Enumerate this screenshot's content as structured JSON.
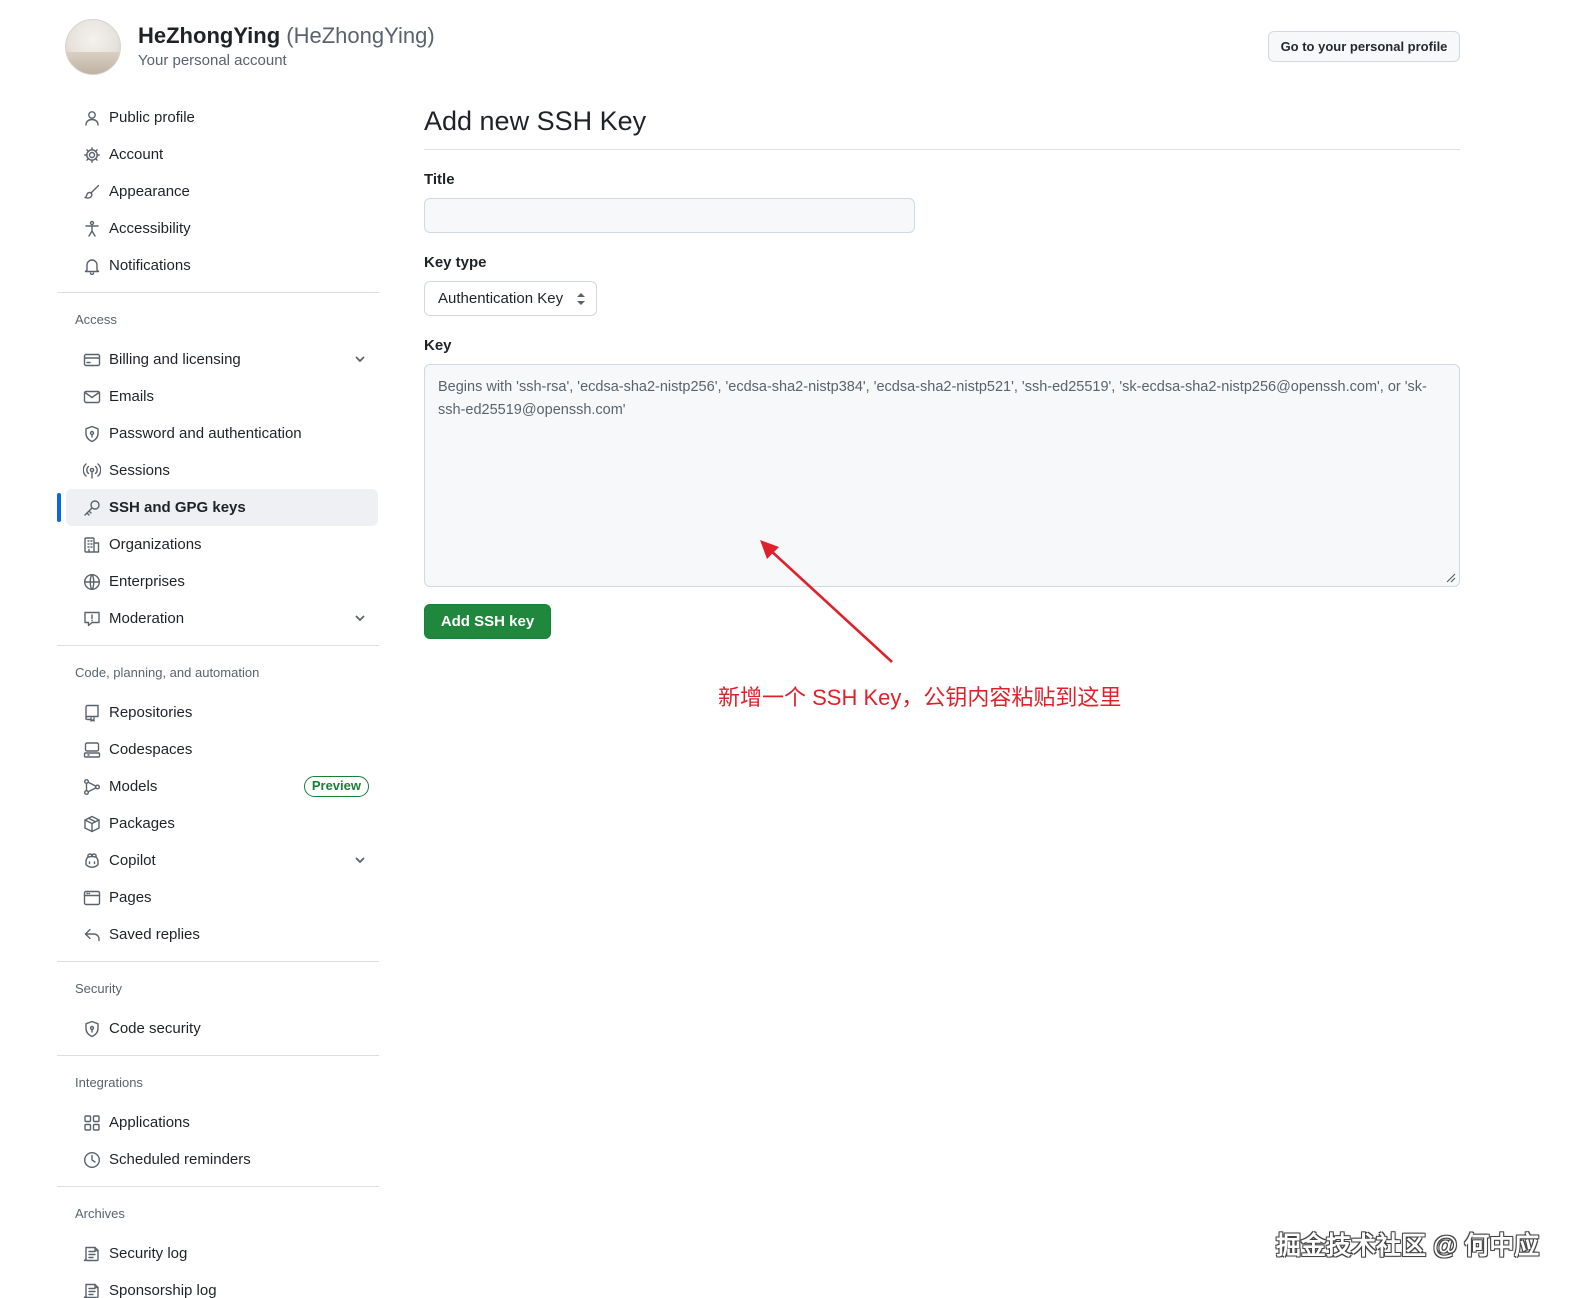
{
  "header": {
    "login": "HeZhongYing",
    "display_name": "(HeZhongYing)",
    "subtitle": "Your personal account",
    "profile_button": "Go to your personal profile"
  },
  "sidebar": {
    "top_items": [
      {
        "label": "Public profile",
        "icon": "person-icon"
      },
      {
        "label": "Account",
        "icon": "gear-icon"
      },
      {
        "label": "Appearance",
        "icon": "paintbrush-icon"
      },
      {
        "label": "Accessibility",
        "icon": "accessibility-icon"
      },
      {
        "label": "Notifications",
        "icon": "bell-icon"
      }
    ],
    "access": {
      "title": "Access",
      "items": [
        {
          "label": "Billing and licensing",
          "icon": "credit-card-icon",
          "expandable": true
        },
        {
          "label": "Emails",
          "icon": "mail-icon"
        },
        {
          "label": "Password and authentication",
          "icon": "shield-lock-icon"
        },
        {
          "label": "Sessions",
          "icon": "broadcast-icon"
        },
        {
          "label": "SSH and GPG keys",
          "icon": "key-icon",
          "active": true
        },
        {
          "label": "Organizations",
          "icon": "organization-icon"
        },
        {
          "label": "Enterprises",
          "icon": "globe-icon"
        },
        {
          "label": "Moderation",
          "icon": "report-icon",
          "expandable": true
        }
      ]
    },
    "code": {
      "title": "Code, planning, and automation",
      "items": [
        {
          "label": "Repositories",
          "icon": "repo-icon"
        },
        {
          "label": "Codespaces",
          "icon": "codespaces-icon"
        },
        {
          "label": "Models",
          "icon": "models-icon",
          "badge": "Preview"
        },
        {
          "label": "Packages",
          "icon": "package-icon"
        },
        {
          "label": "Copilot",
          "icon": "copilot-icon",
          "expandable": true
        },
        {
          "label": "Pages",
          "icon": "browser-icon"
        },
        {
          "label": "Saved replies",
          "icon": "reply-icon"
        }
      ]
    },
    "security": {
      "title": "Security",
      "items": [
        {
          "label": "Code security",
          "icon": "shield-lock-icon"
        }
      ]
    },
    "integrations": {
      "title": "Integrations",
      "items": [
        {
          "label": "Applications",
          "icon": "apps-icon"
        },
        {
          "label": "Scheduled reminders",
          "icon": "clock-icon"
        }
      ]
    },
    "archives": {
      "title": "Archives",
      "items": [
        {
          "label": "Security log",
          "icon": "log-icon"
        },
        {
          "label": "Sponsorship log",
          "icon": "log-icon"
        }
      ]
    }
  },
  "main": {
    "title": "Add new SSH Key",
    "title_label": "Title",
    "title_value": "",
    "key_type_label": "Key type",
    "key_type_value": "Authentication Key",
    "key_label": "Key",
    "key_placeholder": "Begins with 'ssh-rsa', 'ecdsa-sha2-nistp256', 'ecdsa-sha2-nistp384', 'ecdsa-sha2-nistp521', 'ssh-ed25519', 'sk-ecdsa-sha2-nistp256@openssh.com', or 'sk-ssh-ed25519@openssh.com'",
    "submit_label": "Add SSH key"
  },
  "annotation": {
    "text": "新增一个 SSH Key，公钥内容粘贴到这里",
    "color": "#e0202a"
  },
  "watermark": "掘金技术社区 @ 何中应",
  "colors": {
    "accent": "#0969da",
    "primary_button": "#1f883d",
    "badge_green": "#1a7f37"
  }
}
